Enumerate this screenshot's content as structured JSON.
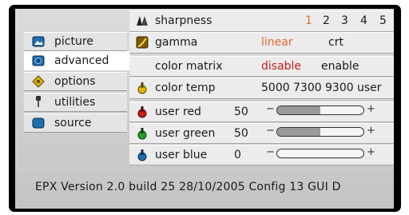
{
  "sidebar": {
    "items": [
      {
        "label": "picture",
        "icon": "picture-icon"
      },
      {
        "label": "advanced",
        "icon": "advanced-icon"
      },
      {
        "label": "options",
        "icon": "options-icon"
      },
      {
        "label": "utilities",
        "icon": "utilities-icon"
      },
      {
        "label": "source",
        "icon": "source-icon"
      }
    ],
    "active": "advanced"
  },
  "settings": {
    "sharpness": {
      "label": "sharpness",
      "options": [
        "1",
        "2",
        "3",
        "4",
        "5"
      ],
      "selected": "1"
    },
    "gamma": {
      "label": "gamma",
      "options": [
        "linear",
        "crt"
      ],
      "selected": "linear"
    },
    "color_matrix": {
      "label": "color matrix",
      "options": [
        "disable",
        "enable"
      ],
      "selected": "disable"
    },
    "color_temp": {
      "label": "color temp",
      "options": [
        "5000",
        "7300",
        "9300",
        "user"
      ]
    },
    "user_red": {
      "label": "user red",
      "value": "50",
      "level": 0.5
    },
    "user_green": {
      "label": "user green",
      "value": "50",
      "level": 0.5
    },
    "user_blue": {
      "label": "user blue",
      "value": "0",
      "level": 0.0
    },
    "minus": "−",
    "plus": "+"
  },
  "colors": {
    "selected_option": "#e36a2c",
    "disable_option": "#cc1b1b",
    "icon_blue": "#1f6fb0"
  },
  "footer": {
    "text": "EPX Version 2.0 build 25   28/10/2005   Config 13   GUI D"
  }
}
